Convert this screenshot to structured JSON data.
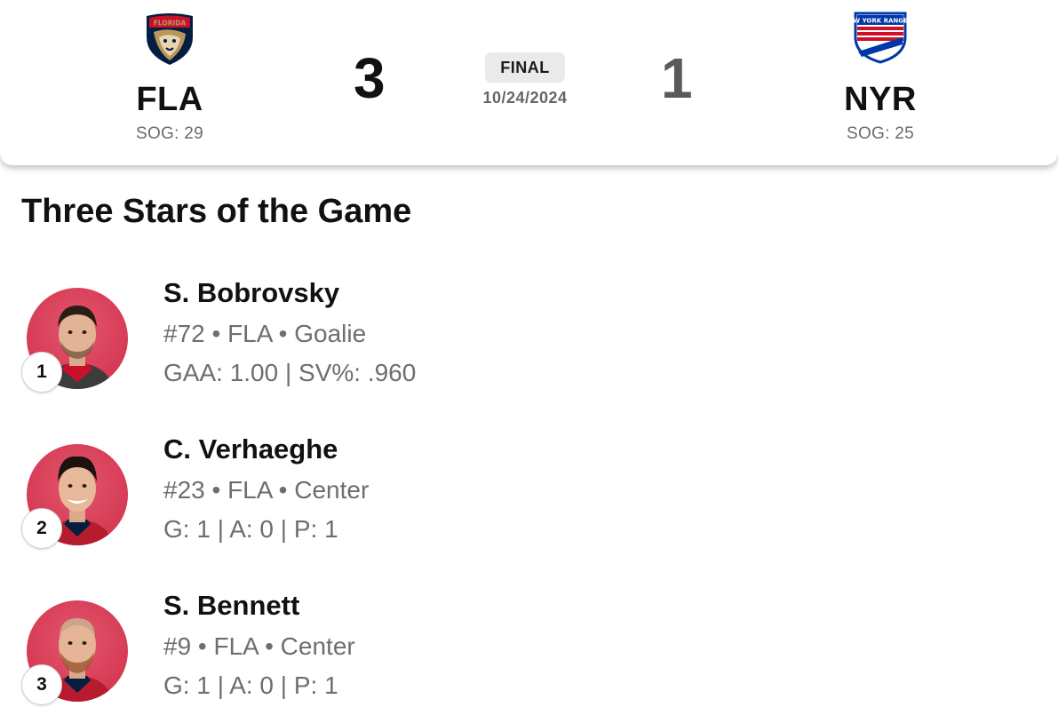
{
  "game": {
    "status": "FINAL",
    "date": "10/24/2024",
    "home": {
      "abbr": "FLA",
      "score": "3",
      "sog": "SOG: 29",
      "logo": "florida-panthers-logo",
      "logo_text": "FLORIDA",
      "color": "#041E42",
      "accent": "#C8102E"
    },
    "away": {
      "abbr": "NYR",
      "score": "1",
      "sog": "SOG: 25",
      "logo": "new-york-rangers-logo",
      "logo_text": "NEW YORK RANGERS",
      "color": "#0038A8",
      "accent": "#CE1126"
    }
  },
  "three_stars": {
    "title": "Three Stars of the Game",
    "stars": [
      {
        "rank": "1",
        "name": "S. Bobrovsky",
        "meta": "#72 • FLA • Goalie",
        "stats": "GAA: 1.00 | SV%: .960"
      },
      {
        "rank": "2",
        "name": "C. Verhaeghe",
        "meta": "#23 • FLA • Center",
        "stats": "G: 1 | A: 0 | P: 1"
      },
      {
        "rank": "3",
        "name": "S. Bennett",
        "meta": "#9 • FLA • Center",
        "stats": "G: 1 | A: 0 | P: 1"
      }
    ]
  },
  "colors": {
    "avatar_bg": "#D63A54",
    "text_primary": "#111111",
    "text_secondary": "#6E6E6E"
  }
}
